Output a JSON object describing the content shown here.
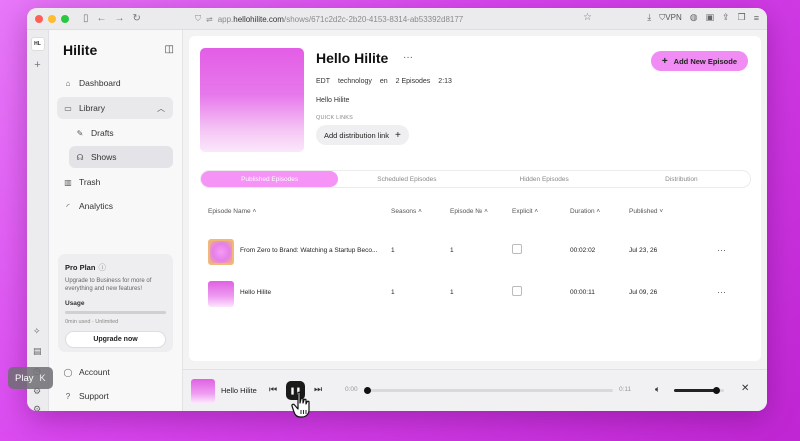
{
  "browser": {
    "url_prefix": "app.",
    "url_host": "hellohilite.com",
    "url_path": "/shows/671c2d2c-2b20-4153-8314-ab53392d8177",
    "vpn_label": "VPN"
  },
  "rail": {
    "logo": "HL"
  },
  "sidebar": {
    "brand": "Hilite",
    "nav": {
      "dashboard": "Dashboard",
      "library": "Library",
      "drafts": "Drafts",
      "shows": "Shows",
      "trash": "Trash",
      "analytics": "Analytics",
      "account": "Account",
      "support": "Support"
    },
    "pro": {
      "title": "Pro Plan",
      "description": "Upgrade to Business for more of everything and new features!",
      "usage_label": "Usage",
      "usage_text": "0min used · Unlimited",
      "upgrade_label": "Upgrade now"
    }
  },
  "show": {
    "title": "Hello Hilite",
    "more": "···",
    "meta": [
      "EDT",
      "technology",
      "en",
      "2 Episodes",
      "2:13"
    ],
    "description": "Hello Hilite",
    "quick_links_label": "QUICK LINKS",
    "add_distribution_label": "Add distribution link",
    "add_episode_label": "Add New Episode"
  },
  "tabs": [
    "Published Episodes",
    "Scheduled Episodes",
    "Hidden Episodes",
    "Distribution"
  ],
  "table": {
    "headers": {
      "name": "Episode Name",
      "seasons": "Seasons",
      "episode_no": "Episode №",
      "explicit": "Explicit",
      "duration": "Duration",
      "published": "Published"
    },
    "rows": [
      {
        "name": "From Zero to Brand: Watching a Startup Beco...",
        "seasons": "1",
        "episode_no": "1",
        "duration": "00:02:02",
        "published": "Jul 23, 26",
        "more": "···"
      },
      {
        "name": "Hello Hilite",
        "seasons": "1",
        "episode_no": "1",
        "duration": "00:00:11",
        "published": "Jul 09, 26",
        "more": "···"
      }
    ]
  },
  "player": {
    "title": "Hello Hilite",
    "current_time": "0:00",
    "duration": "0:11",
    "progress": 0.0,
    "volume": 0.85
  },
  "tooltip": {
    "label": "Play",
    "shortcut": "K"
  },
  "colors": {
    "accent": "#f08cf3",
    "tab_active": "#f593f6",
    "background": "#d946ef"
  },
  "icons": {
    "dashboard": "home-icon",
    "library": "folder-icon",
    "drafts": "pencil-icon",
    "shows": "headphones-icon",
    "trash": "trash-icon",
    "analytics": "signal-icon",
    "account": "user-icon",
    "support": "help-icon"
  }
}
